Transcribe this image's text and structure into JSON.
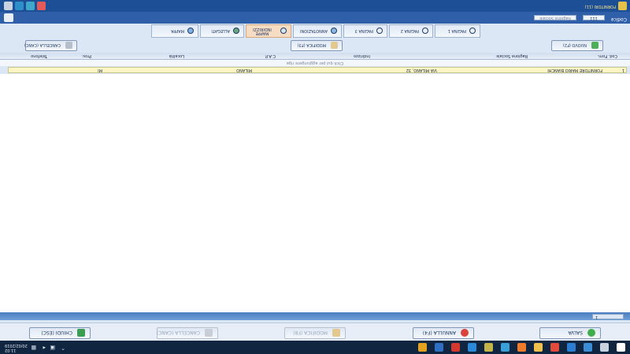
{
  "taskbar": {
    "time": "11:02",
    "date": "20/02/2019",
    "apps": [
      {
        "name": "windows-icon",
        "color": "#ffffff"
      },
      {
        "name": "task-view-icon",
        "color": "#c9d3e0"
      },
      {
        "name": "store-icon",
        "color": "#3b8ed6"
      },
      {
        "name": "edge-icon",
        "color": "#2c7fd0"
      },
      {
        "name": "chrome-icon",
        "color": "#e24b3b"
      },
      {
        "name": "folder-icon",
        "color": "#f0c24b"
      },
      {
        "name": "firefox-icon",
        "color": "#f07b2a"
      },
      {
        "name": "app-icon",
        "color": "#3aa0d8"
      },
      {
        "name": "app-active-icon",
        "color": "#c4b54a"
      },
      {
        "name": "browser-icon",
        "color": "#2b8ad8"
      },
      {
        "name": "red-app-icon",
        "color": "#d6372f"
      },
      {
        "name": "blue-app-icon",
        "color": "#2e6fc2"
      },
      {
        "name": "media-icon",
        "color": "#e4a21e"
      }
    ]
  },
  "toolbar": {
    "save": "SALVA",
    "cancel": "ANNULLA (F4)",
    "edit": "MODIFICA (F8)",
    "delete": "CANCELLA (CANC)",
    "close": "CHIUDI (ESC)"
  },
  "grid": {
    "header_cell": "1"
  },
  "selected_row": {
    "marker": "1",
    "company": "FORNITORE MARIO BIANCHI",
    "address": "VIA MILANO, 32",
    "city": "MILANO",
    "province": "MI"
  },
  "status_line": "Click qui per aggiungere riga",
  "columns": [
    "Cod. Forn.",
    "Ragione Sociale",
    "Indirizzo",
    "C.A.P.",
    "Località",
    "Prov.",
    "Telefono"
  ],
  "actions": {
    "new": "NUOVO (F2)",
    "edit": "MODIFICA (F3)",
    "delete": "CANCELLA (CANC)"
  },
  "tabs": [
    {
      "label": "PAGINA 1",
      "active": false
    },
    {
      "label": "PAGINA 2",
      "active": false
    },
    {
      "label": "PAGINA 3",
      "active": false
    },
    {
      "label": "ANNOTAZIONI",
      "active": false
    },
    {
      "label": "MAPPE INDIRIZZI",
      "active": true
    },
    {
      "label": "ALLEGATI",
      "active": false
    },
    {
      "label": "MAPPA",
      "active": false
    }
  ],
  "bottom_bar": {
    "code_label": "Codice",
    "code_value": "111",
    "name_field": "Ragione Sociale"
  },
  "footer": {
    "label": "FORNITORI (11)"
  },
  "colors": {
    "header_blue": "#4b7ec1",
    "selected_row": "#fdf6c4",
    "active_tab": "#f6dcc3"
  }
}
